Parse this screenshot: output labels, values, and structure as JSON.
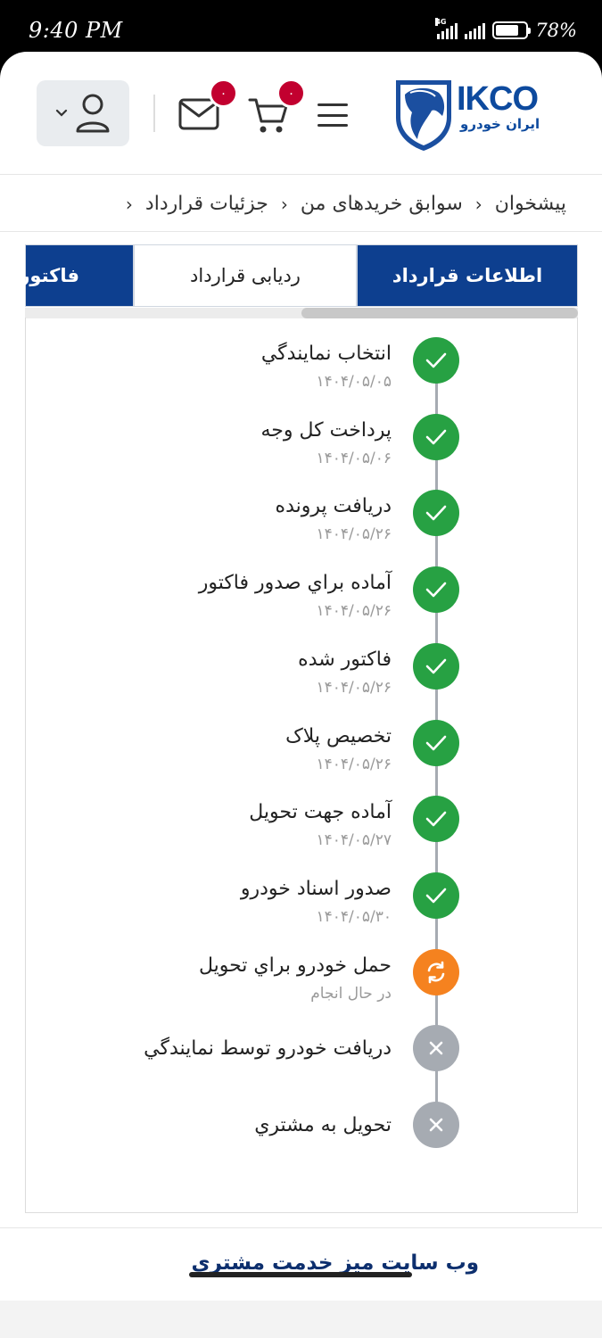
{
  "status_bar": {
    "time": "9:40 PM",
    "network": "4G",
    "battery_percent": "78%",
    "battery_level": 0.78
  },
  "header": {
    "logo_brand": "IKCO",
    "logo_subtitle": "ایران خودرو",
    "mail_badge": "۰",
    "cart_badge": "۰",
    "icons": [
      "user-icon",
      "chevron-down-icon",
      "mail-icon",
      "cart-icon",
      "menu-icon",
      "ikco-horse-logo"
    ]
  },
  "breadcrumb": {
    "items": [
      "پیشخوان",
      "سوابق خریدهای من",
      "جزئیات قرارداد"
    ]
  },
  "tabs": {
    "items": [
      {
        "label": "اطلاعات قرارداد",
        "state": "active"
      },
      {
        "label": "ردیابی قرارداد",
        "state": "selected"
      },
      {
        "label": "فاکتور",
        "state": "active"
      }
    ]
  },
  "tracking": {
    "steps": [
      {
        "title": "انتخاب نمايندگي",
        "date": "۱۴۰۴/۰۵/۰۵",
        "status": "done"
      },
      {
        "title": "پرداخت کل وجه",
        "date": "۱۴۰۴/۰۵/۰۶",
        "status": "done"
      },
      {
        "title": "دريافت پرونده",
        "date": "۱۴۰۴/۰۵/۲۶",
        "status": "done"
      },
      {
        "title": "آماده براي صدور فاکتور",
        "date": "۱۴۰۴/۰۵/۲۶",
        "status": "done"
      },
      {
        "title": "فاکتور شده",
        "date": "۱۴۰۴/۰۵/۲۶",
        "status": "done"
      },
      {
        "title": "تخصيص پلاک",
        "date": "۱۴۰۴/۰۵/۲۶",
        "status": "done"
      },
      {
        "title": "آماده جهت تحويل",
        "date": "۱۴۰۴/۰۵/۲۷",
        "status": "done"
      },
      {
        "title": "صدور اسناد خودرو",
        "date": "۱۴۰۴/۰۵/۳۰",
        "status": "done"
      },
      {
        "title": "حمل خودرو براي تحويل",
        "date": "در حال انجام",
        "status": "in-progress"
      },
      {
        "title": "دريافت خودرو توسط نمايندگي",
        "date": "",
        "status": "pending"
      },
      {
        "title": "تحويل به مشتري",
        "date": "",
        "status": "pending"
      }
    ]
  },
  "footer": {
    "link_label": "وب سایت میز خدمت مشتری"
  },
  "colors": {
    "primary": "#0d3f8f",
    "done": "#27a143",
    "in_progress": "#f5821f",
    "pending": "#a6abb2",
    "badge": "#c2002f"
  }
}
